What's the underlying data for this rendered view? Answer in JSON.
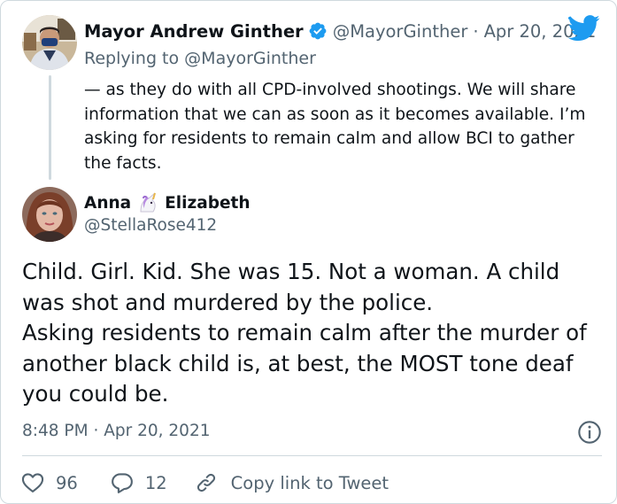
{
  "parent_tweet": {
    "author_name": "Mayor Andrew Ginther",
    "handle": "@MayorGinther",
    "separator": "·",
    "date": "Apr 20, 2021",
    "replying_prefix": "Replying to",
    "replying_to": "@MayorGinther",
    "text": "— as they do with all CPD-involved shootings. We will share information that we can as soon as it becomes available. I’m asking for residents to remain calm and allow BCI to gather the facts.",
    "verified": true,
    "verified_icon": "verified-badge-icon",
    "avatar_icon": "avatar-photo"
  },
  "reply_tweet": {
    "author_first": "Anna",
    "author_emoji_icon": "unicorn-icon",
    "author_last": "Elizabeth",
    "handle": "@StellaRose412",
    "text_line1": "Child. Girl. Kid. She was 15. Not a woman. A child was shot and murdered by the police.",
    "text_line2": "Asking residents to remain calm after the murder of another black child is, at best, the MOST tone deaf you could be.",
    "time": "8:48 PM",
    "separator": "·",
    "date": "Apr 20, 2021",
    "avatar_icon": "avatar-photo"
  },
  "actions": {
    "likes": "96",
    "replies": "12",
    "copy_link_label": "Copy link to Tweet"
  },
  "colors": {
    "text": "#0f1419",
    "muted": "#536471",
    "brand": "#1d9bf0",
    "border": "#cfd9de"
  }
}
